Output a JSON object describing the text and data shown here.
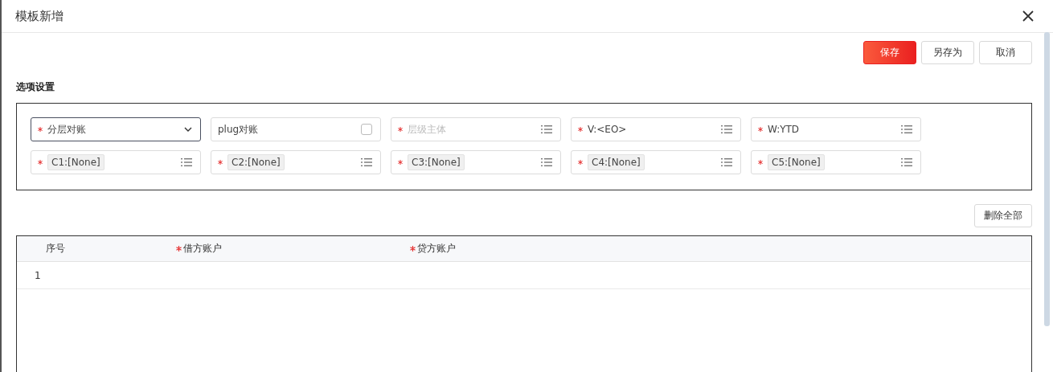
{
  "dialog": {
    "title": "模板新增"
  },
  "actions": [
    {
      "label": "保存",
      "primary": true
    },
    {
      "label": "另存为",
      "primary": false
    },
    {
      "label": "取消",
      "primary": false
    }
  ],
  "options": {
    "title": "选项设置",
    "fields": [
      {
        "kind": "select",
        "required": true,
        "value": "分层对账",
        "focused": true
      },
      {
        "kind": "checkbox",
        "required": false,
        "value": "plug对账",
        "checked": false
      },
      {
        "kind": "picker",
        "required": true,
        "placeholder": "层级主体"
      },
      {
        "kind": "picker",
        "required": true,
        "value": "V:<EO>"
      },
      {
        "kind": "picker",
        "required": true,
        "value": "W:YTD"
      },
      {
        "kind": "picker",
        "required": true,
        "tag": "C1:[None]"
      },
      {
        "kind": "picker",
        "required": true,
        "tag": "C2:[None]"
      },
      {
        "kind": "picker",
        "required": true,
        "tag": "C3:[None]"
      },
      {
        "kind": "picker",
        "required": true,
        "tag": "C4:[None]"
      },
      {
        "kind": "picker",
        "required": true,
        "tag": "C5:[None]"
      }
    ]
  },
  "delete_all": {
    "label": "删除全部"
  },
  "table": {
    "columns": [
      {
        "label": "序号",
        "required": false
      },
      {
        "label": "借方账户",
        "required": true
      },
      {
        "label": "贷方账户",
        "required": true
      }
    ],
    "rows": [
      [
        "1",
        "",
        ""
      ]
    ]
  }
}
